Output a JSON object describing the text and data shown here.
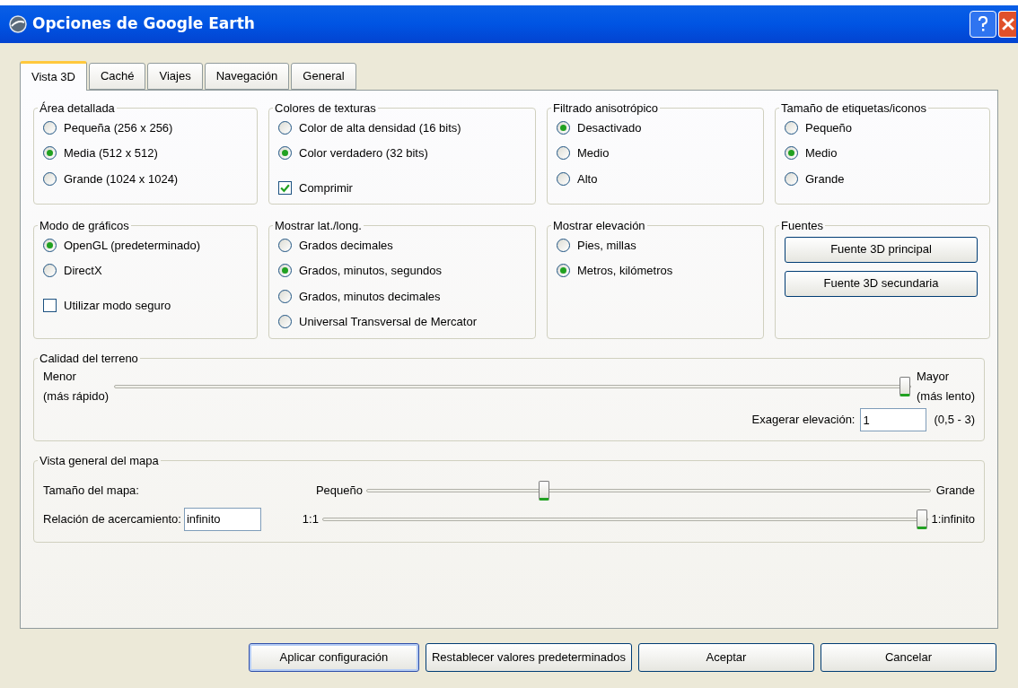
{
  "window": {
    "title": "Opciones de Google Earth"
  },
  "tabs": [
    {
      "label": "Vista 3D",
      "selected": true
    },
    {
      "label": "Caché",
      "selected": false
    },
    {
      "label": "Viajes",
      "selected": false
    },
    {
      "label": "Navegación",
      "selected": false
    },
    {
      "label": "General",
      "selected": false
    }
  ],
  "groups": [
    {
      "title": "Área detallada",
      "items": [
        {
          "kind": "radio",
          "label": "Pequeña (256 x 256)",
          "selected": false
        },
        {
          "kind": "radio",
          "label": "Media (512 x 512)",
          "selected": true
        },
        {
          "kind": "radio",
          "label": "Grande (1024 x 1024)",
          "selected": false
        }
      ]
    },
    {
      "title": "Colores de texturas",
      "items": [
        {
          "kind": "radio",
          "label": "Color de alta densidad (16 bits)",
          "selected": false
        },
        {
          "kind": "radio",
          "label": "Color verdadero (32 bits)",
          "selected": true
        },
        {
          "kind": "checkbox",
          "label": "Comprimir",
          "checked": true
        }
      ]
    },
    {
      "title": "Filtrado anisotrópico",
      "items": [
        {
          "kind": "radio",
          "label": "Desactivado",
          "selected": true
        },
        {
          "kind": "radio",
          "label": "Medio",
          "selected": false
        },
        {
          "kind": "radio",
          "label": "Alto",
          "selected": false
        }
      ]
    },
    {
      "title": "Tamaño de etiquetas/iconos",
      "items": [
        {
          "kind": "radio",
          "label": "Pequeño",
          "selected": false
        },
        {
          "kind": "radio",
          "label": "Medio",
          "selected": true
        },
        {
          "kind": "radio",
          "label": "Grande",
          "selected": false
        }
      ]
    },
    {
      "title": "Modo de gráficos",
      "items": [
        {
          "kind": "radio",
          "label": "OpenGL (predeterminado)",
          "selected": true
        },
        {
          "kind": "radio",
          "label": "DirectX",
          "selected": false
        },
        {
          "kind": "checkbox",
          "label": "Utilizar modo seguro",
          "checked": false
        }
      ]
    },
    {
      "title": "Mostrar lat./long.",
      "items": [
        {
          "kind": "radio",
          "label": "Grados decimales",
          "selected": false
        },
        {
          "kind": "radio",
          "label": "Grados, minutos, segundos",
          "selected": true
        },
        {
          "kind": "radio",
          "label": "Grados, minutos decimales",
          "selected": false
        },
        {
          "kind": "radio",
          "label": "Universal Transversal de Mercator",
          "selected": false
        }
      ]
    },
    {
      "title": "Mostrar elevación",
      "items": [
        {
          "kind": "radio",
          "label": "Pies, millas",
          "selected": false
        },
        {
          "kind": "radio",
          "label": "Metros, kilómetros",
          "selected": true
        }
      ]
    },
    {
      "title": "Fuentes",
      "items": [
        {
          "kind": "button",
          "label": "Fuente 3D principal"
        },
        {
          "kind": "button",
          "label": "Fuente 3D secundaria"
        }
      ]
    }
  ],
  "terrain": {
    "title": "Calidad del terreno",
    "min_label": "Menor\n(más rápido)",
    "max_label": "Mayor\n(más lento)",
    "level": 1,
    "exaggeration_label": "Exagerar elevación:",
    "exaggeration_value": "1",
    "exaggeration_range": "(0,5 - 3)"
  },
  "map_overview": {
    "title": "Vista general del mapa",
    "size": {
      "label": "Tamaño del mapa:",
      "min_label": "Pequeño",
      "max_label": "Grande",
      "level": 0.31
    },
    "zoom": {
      "label": "Relación de acercamiento:",
      "value": "infinito",
      "min_label": "1:1",
      "max_label": "1:infinito",
      "level": 1
    }
  },
  "buttons": [
    {
      "label": "Aplicar configuración",
      "focused": true
    },
    {
      "label": "Restablecer valores predeterminados",
      "focused": false
    },
    {
      "label": "Aceptar",
      "focused": false
    },
    {
      "label": "Cancelar",
      "focused": false
    }
  ]
}
